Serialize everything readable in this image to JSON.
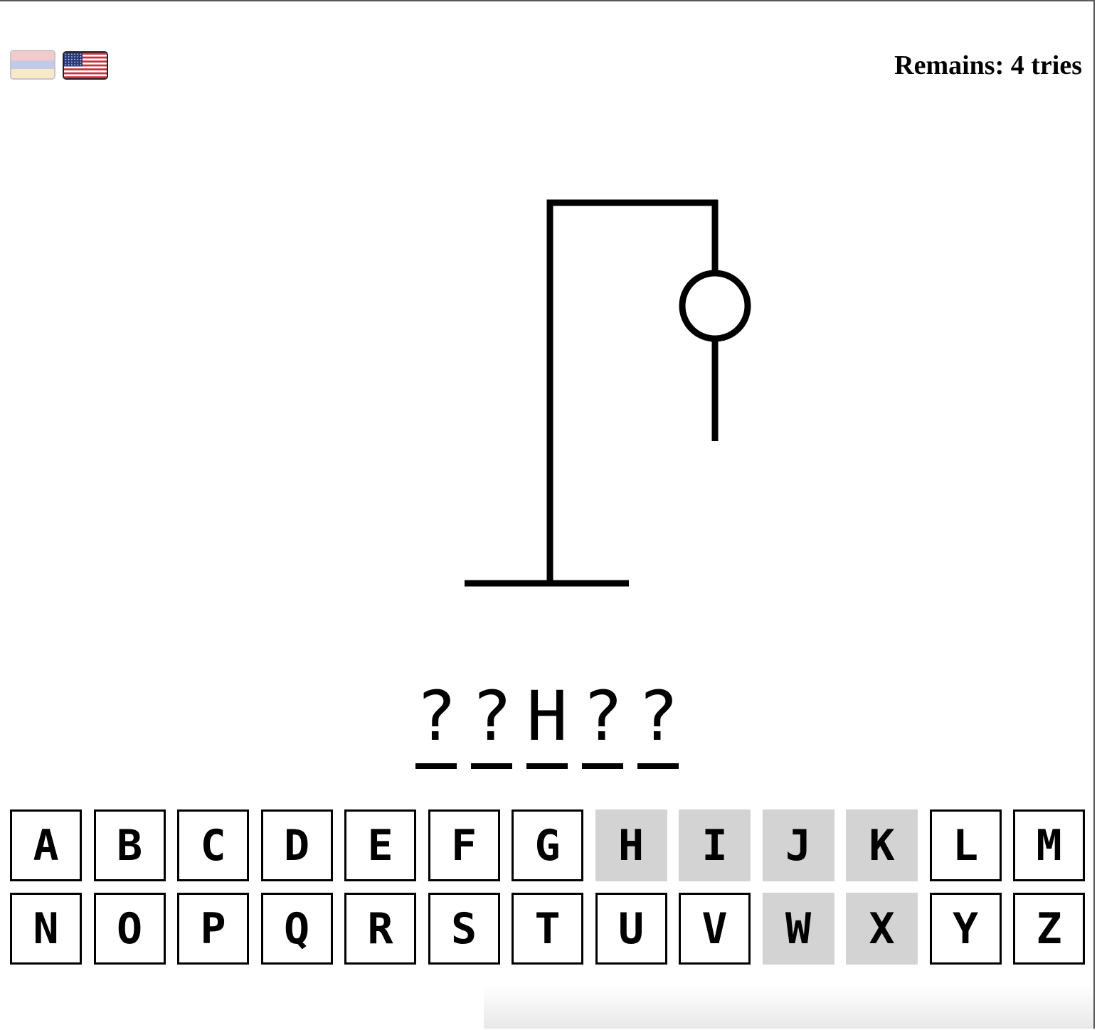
{
  "header": {
    "languages": [
      {
        "name": "armenian-flag-icon",
        "colors": [
          "#ed9fa3",
          "#8f9fd4",
          "#f5d6a0"
        ],
        "active": false
      },
      {
        "name": "us-flag-icon",
        "active": true
      }
    ],
    "remains_text": "Remains: 4 tries"
  },
  "game": {
    "remaining_tries": 4,
    "figure_parts_drawn": [
      "base",
      "pole",
      "beam",
      "rope",
      "head",
      "body"
    ],
    "word_slots": [
      "?",
      "?",
      "H",
      "?",
      "?"
    ]
  },
  "keyboard": {
    "keys": [
      {
        "letter": "A",
        "used": false
      },
      {
        "letter": "B",
        "used": false
      },
      {
        "letter": "C",
        "used": false
      },
      {
        "letter": "D",
        "used": false
      },
      {
        "letter": "E",
        "used": false
      },
      {
        "letter": "F",
        "used": false
      },
      {
        "letter": "G",
        "used": false
      },
      {
        "letter": "H",
        "used": true
      },
      {
        "letter": "I",
        "used": true
      },
      {
        "letter": "J",
        "used": true
      },
      {
        "letter": "K",
        "used": true
      },
      {
        "letter": "L",
        "used": false
      },
      {
        "letter": "M",
        "used": false
      },
      {
        "letter": "N",
        "used": false
      },
      {
        "letter": "O",
        "used": false
      },
      {
        "letter": "P",
        "used": false
      },
      {
        "letter": "Q",
        "used": false
      },
      {
        "letter": "R",
        "used": false
      },
      {
        "letter": "S",
        "used": false
      },
      {
        "letter": "T",
        "used": false
      },
      {
        "letter": "U",
        "used": false
      },
      {
        "letter": "V",
        "used": false
      },
      {
        "letter": "W",
        "used": true
      },
      {
        "letter": "X",
        "used": true
      },
      {
        "letter": "Y",
        "used": false
      },
      {
        "letter": "Z",
        "used": false
      }
    ]
  }
}
